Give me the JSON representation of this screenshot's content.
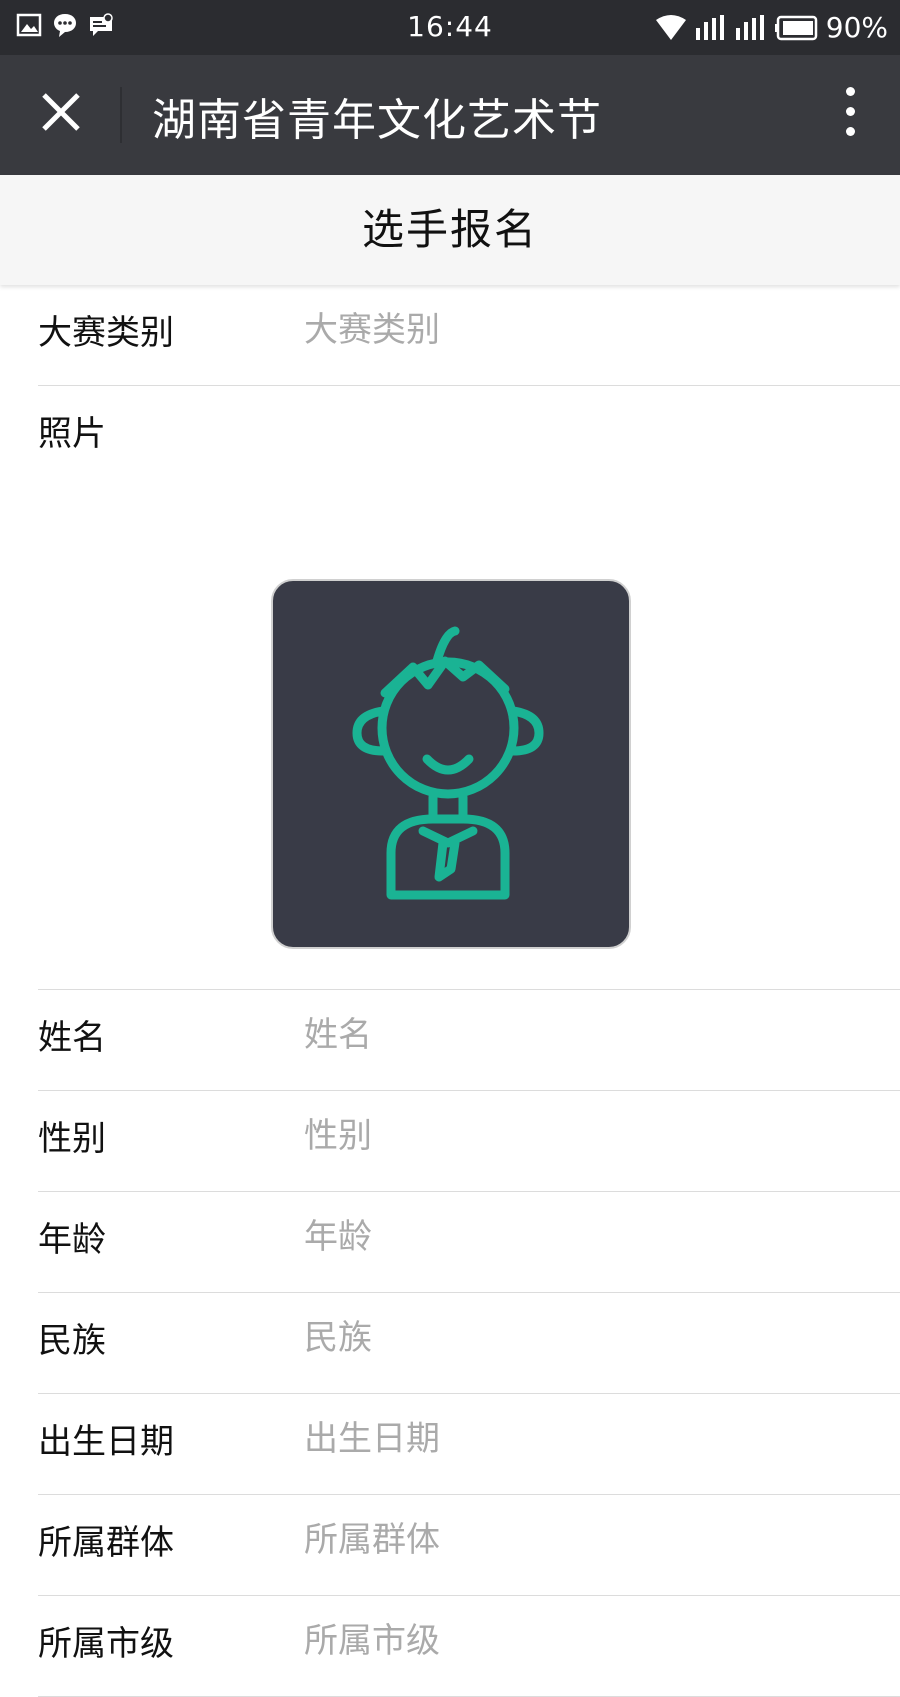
{
  "status_bar": {
    "time": "16:44",
    "battery": "90%",
    "left_icons": [
      "image-icon",
      "chat-icon",
      "message-icon"
    ],
    "right_icons": [
      "wifi-icon",
      "signal-icon",
      "signal-icon",
      "battery-icon"
    ]
  },
  "header": {
    "title": "湖南省青年文化艺术节",
    "close_icon": "close-icon",
    "more_icon": "more-vertical-icon"
  },
  "page": {
    "title": "选手报名"
  },
  "form": {
    "contest_category": {
      "label": "大赛类别",
      "placeholder": "大赛类别"
    },
    "photo": {
      "label": "照片",
      "icon": "avatar-placeholder-icon",
      "accent": "#1ab394"
    },
    "name": {
      "label": "姓名",
      "placeholder": "姓名"
    },
    "gender": {
      "label": "性别",
      "placeholder": "性别"
    },
    "age": {
      "label": "年龄",
      "placeholder": "年龄"
    },
    "ethnicity": {
      "label": "民族",
      "placeholder": "民族"
    },
    "birth_date": {
      "label": "出生日期",
      "placeholder": "出生日期"
    },
    "group": {
      "label": "所属群体",
      "placeholder": "所属群体"
    },
    "city": {
      "label": "所属市级",
      "placeholder": "所属市级"
    }
  },
  "colors": {
    "status_bar": "#2b2c30",
    "header": "#393a3f",
    "title_bar": "#f6f6f6",
    "photo_bg": "#393b47",
    "accent": "#1ab394"
  }
}
